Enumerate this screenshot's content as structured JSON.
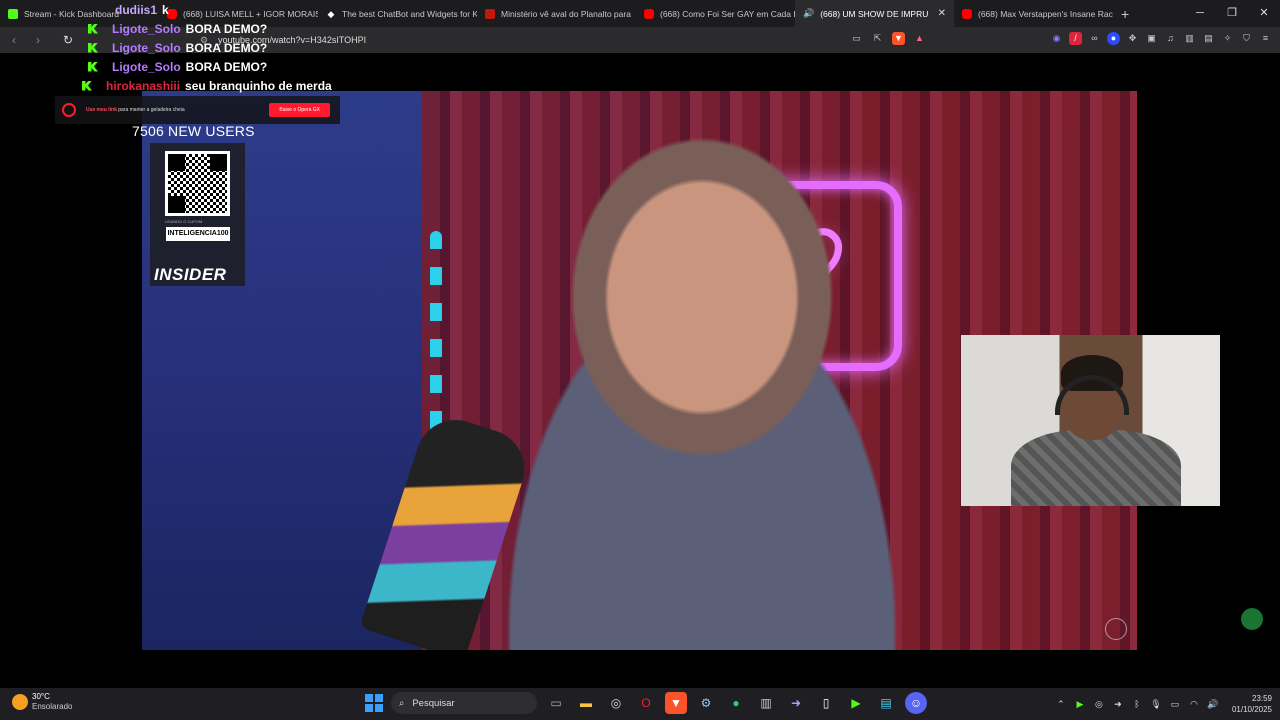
{
  "browser": {
    "tabs": [
      {
        "label": "Stream - Kick Dashboard",
        "favicon": "kick-icon",
        "active": false
      },
      {
        "label": "(668) LUISA MELL + IGOR MORAIS",
        "favicon": "youtube-icon",
        "active": false
      },
      {
        "label": "The best ChatBot and Widgets for K",
        "favicon": "diamond-icon",
        "active": false
      },
      {
        "label": "Ministério vê aval do Planalto para",
        "favicon": "g1-icon",
        "active": false
      },
      {
        "label": "(668) Como Foi Ser GAY em Cada É",
        "favicon": "youtube-icon",
        "active": false
      },
      {
        "label": "(668) UM SHOW DE IMPRU",
        "favicon": "youtube-icon",
        "active": true
      },
      {
        "label": "(668) Max Verstappen's Insane Raci",
        "favicon": "youtube-icon",
        "active": false
      }
    ],
    "new_tab": "+",
    "url": "youtube.com/watch?v=H342sITOHPI"
  },
  "overlay": {
    "chat": [
      {
        "user": "dudiis1",
        "message": "k",
        "user_color": "#c8a8ff"
      },
      {
        "user": "Ligote_Solo",
        "message": "BORA DEMO?",
        "user_color": "#b47cff"
      },
      {
        "user": "Ligote_Solo",
        "message": "BORA DEMO?",
        "user_color": "#b47cff"
      },
      {
        "user": "Ligote_Solo",
        "message": "BORA DEMO?",
        "user_color": "#b47cff"
      },
      {
        "user": "hirokanashiii",
        "message": "seu branquinho de merda",
        "user_color": "#e0243a"
      }
    ],
    "promo_text_highlight": "Use meu link",
    "promo_text": "para manter a geladeira cheia",
    "promo_button": "Baixe o Opera GX",
    "new_users": "7506 NEW USERS",
    "coupon_label": "USANDO O CUPOM",
    "coupon_code": "INTELIGENCIA100",
    "insider_logo": "INSIDER",
    "brand_color": "#53fc18"
  },
  "taskbar": {
    "temperature": "30°C",
    "condition": "Ensolarado",
    "search_placeholder": "Pesquisar",
    "time": "23:59",
    "date": "01/10/2025"
  }
}
